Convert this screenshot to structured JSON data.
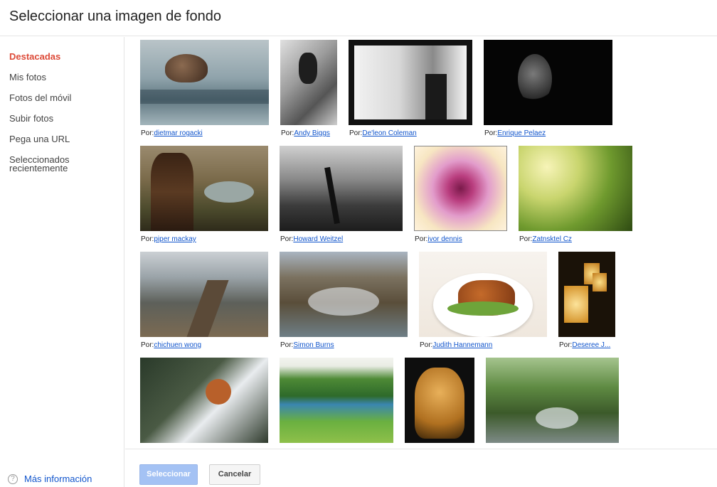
{
  "dialog": {
    "title": "Seleccionar una imagen de fondo"
  },
  "sidebar": {
    "items": [
      {
        "label": "Destacadas",
        "active": true
      },
      {
        "label": "Mis fotos"
      },
      {
        "label": "Fotos del móvil"
      },
      {
        "label": "Subir fotos"
      },
      {
        "label": "Pega una URL"
      },
      {
        "label": "Seleccionados recientemente"
      }
    ],
    "help_label": "Más información",
    "help_icon": "question-circle-icon"
  },
  "photo_prefix": "Por:",
  "photos": [
    {
      "author": "dietmar rogacki",
      "subject": "snail"
    },
    {
      "author": "Andy Biggs",
      "subject": "chimpanzee"
    },
    {
      "author": "De'leon Coleman",
      "subject": "wedding-couple"
    },
    {
      "author": "Enrique Pelaez",
      "subject": "dark-rose"
    },
    {
      "author": "piper mackay",
      "subject": "tribal-portrait"
    },
    {
      "author": "Howard Weitzel",
      "subject": "bare-tree"
    },
    {
      "author": "ivor dennis",
      "subject": "dahlia"
    },
    {
      "author": "Zatnsktel Cz",
      "subject": "sunlit-forest"
    },
    {
      "author": "chichuen wong",
      "subject": "great-wall"
    },
    {
      "author": "Simon Burns",
      "subject": "rocky-stream"
    },
    {
      "author": "Judith Hannemann",
      "subject": "grilled-chicken"
    },
    {
      "author": "Deseree J...",
      "subject": "paper-lanterns"
    },
    {
      "author": "",
      "subject": "squirrel-in-snow"
    },
    {
      "author": "",
      "subject": "mountain-lake"
    },
    {
      "author": "",
      "subject": "leopard"
    },
    {
      "author": "",
      "subject": "forest-creek"
    }
  ],
  "footer": {
    "select_label": "Seleccionar",
    "cancel_label": "Cancelar"
  },
  "colors": {
    "active_nav": "#dd4b39",
    "link": "#1155cc",
    "select_button": "#a4c2f4"
  }
}
